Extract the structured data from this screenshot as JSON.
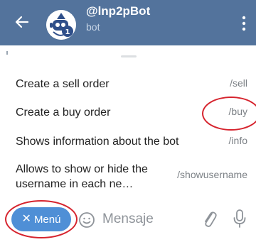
{
  "header": {
    "back_icon": "arrow-left-icon",
    "title": "@lnp2pBot",
    "subtitle": "bot",
    "avatar_icon": "robot-avatar-icon",
    "more_icon": "more-vertical-icon",
    "background_color": "#53739c"
  },
  "commands": [
    {
      "description": "Create a sell order",
      "command": "/sell"
    },
    {
      "description": "Create a buy order",
      "command": "/buy"
    },
    {
      "description": "Shows information about the bot",
      "command": "/info"
    },
    {
      "description": "Allows to show or hide the username in each ne…",
      "command": "/showusername"
    }
  ],
  "input_bar": {
    "menu_label": "Menú",
    "menu_icon": "close-icon",
    "emoji_icon": "emoji-icon",
    "placeholder": "Mensaje",
    "attach_icon": "paperclip-icon",
    "mic_icon": "microphone-icon",
    "menu_color": "#4f8fd6"
  },
  "annotation_color": "#d6242e"
}
